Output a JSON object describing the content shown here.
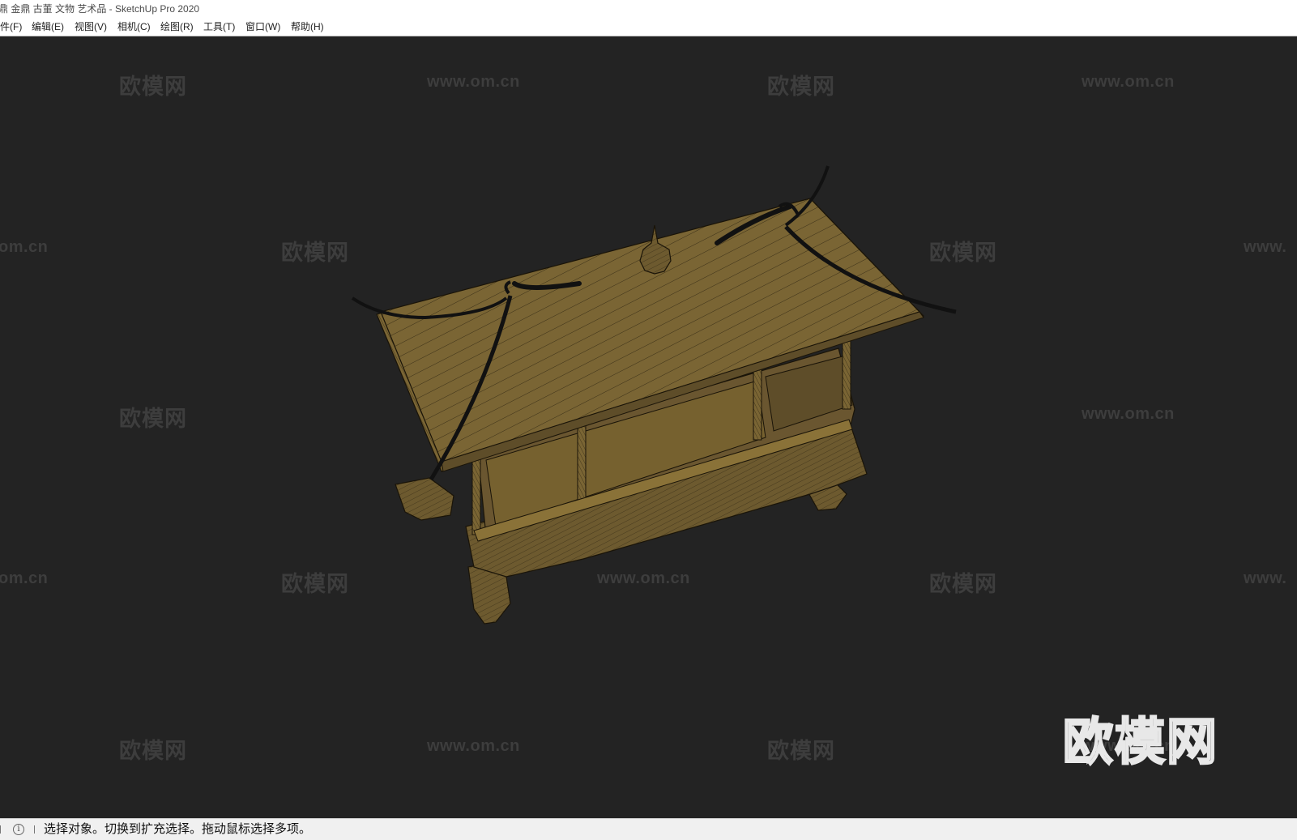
{
  "window": {
    "title": "鼎 金鼎 古董 文物 艺术品 - SketchUp Pro 2020"
  },
  "menu": [
    {
      "label": "件(F)"
    },
    {
      "label": "编辑(E)"
    },
    {
      "label": "视图(V)"
    },
    {
      "label": "相机(C)"
    },
    {
      "label": "绘图(R)"
    },
    {
      "label": "工具(T)"
    },
    {
      "label": "窗口(W)"
    },
    {
      "label": "帮助(H)"
    }
  ],
  "watermark": {
    "brand": "欧模网",
    "url": "www.om.cn",
    "url_cut_left": "om.cn",
    "url_cut_right": "www."
  },
  "logo": {
    "text": "欧模网"
  },
  "statusbar": {
    "info_icon": "i",
    "text": "选择对象。切换到扩充选择。拖动鼠标选择多项。"
  },
  "colors": {
    "background": "#232323",
    "model_fill": "#7a6534",
    "model_line": "#1a1408",
    "watermark": "#3d3d3d"
  },
  "icons": [
    "info-icon"
  ]
}
